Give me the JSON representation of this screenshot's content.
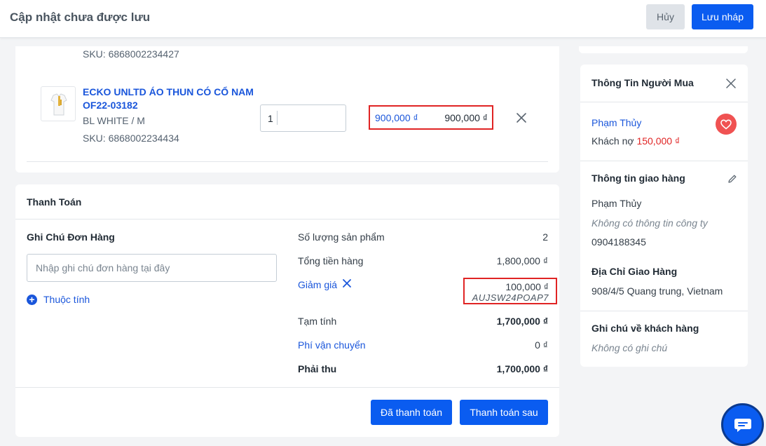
{
  "header": {
    "title": "Cập nhật chưa được lưu",
    "cancel_label": "Hủy",
    "save_draft_label": "Lưu nháp"
  },
  "product": {
    "prev_sku": "SKU: 6868002234427",
    "name": "ECKO UNLTD ÁO THUN CÓ CỔ NAM OF22-03182",
    "variant": "BL WHITE / M",
    "sku": "SKU: 6868002234434",
    "quantity": "1",
    "unit_price": "900,000 ₫",
    "line_total": "900,000 ₫"
  },
  "payment": {
    "title": "Thanh Toán",
    "note_title": "Ghi Chú Đơn Hàng",
    "note_placeholder": "Nhập ghi chú đơn hàng tại đây",
    "attribute_link": "Thuộc tính",
    "rows": {
      "qty_label": "Số lượng sản phẩm",
      "qty_value": "2",
      "subtotal_label": "Tổng tiền hàng",
      "subtotal_value": "1,800,000 ₫",
      "discount_label": "Giảm giá",
      "discount_value": "100,000 ₫",
      "discount_code": "AUJSW24POAP7",
      "provisional_label": "Tạm tính",
      "provisional_value": "1,700,000 ₫",
      "shipping_label": "Phí vận chuyển",
      "shipping_value": "0 ₫",
      "due_label": "Phải thu",
      "due_value": "1,700,000 ₫"
    },
    "paid_button": "Đã thanh toán",
    "pay_later_button": "Thanh toán sau"
  },
  "buyer": {
    "title": "Thông Tin Người Mua",
    "name": "Phạm Thủy",
    "debt_label": "Khách nợ",
    "debt_amount": "150,000 ₫",
    "shipping_title": "Thông tin giao hàng",
    "ship_name": "Phạm Thủy",
    "no_company": "Không có thông tin công ty",
    "phone": "0904188345",
    "address_title": "Địa Chỉ Giao Hàng",
    "address": "908/4/5 Quang trung, Vietnam",
    "customer_note_title": "Ghi chú về khách hàng",
    "no_note": "Không có ghi chú"
  },
  "colors": {
    "primary": "#0a5cf0",
    "link": "#1a56db",
    "highlight": "#e02424",
    "heart": "#f05252"
  }
}
